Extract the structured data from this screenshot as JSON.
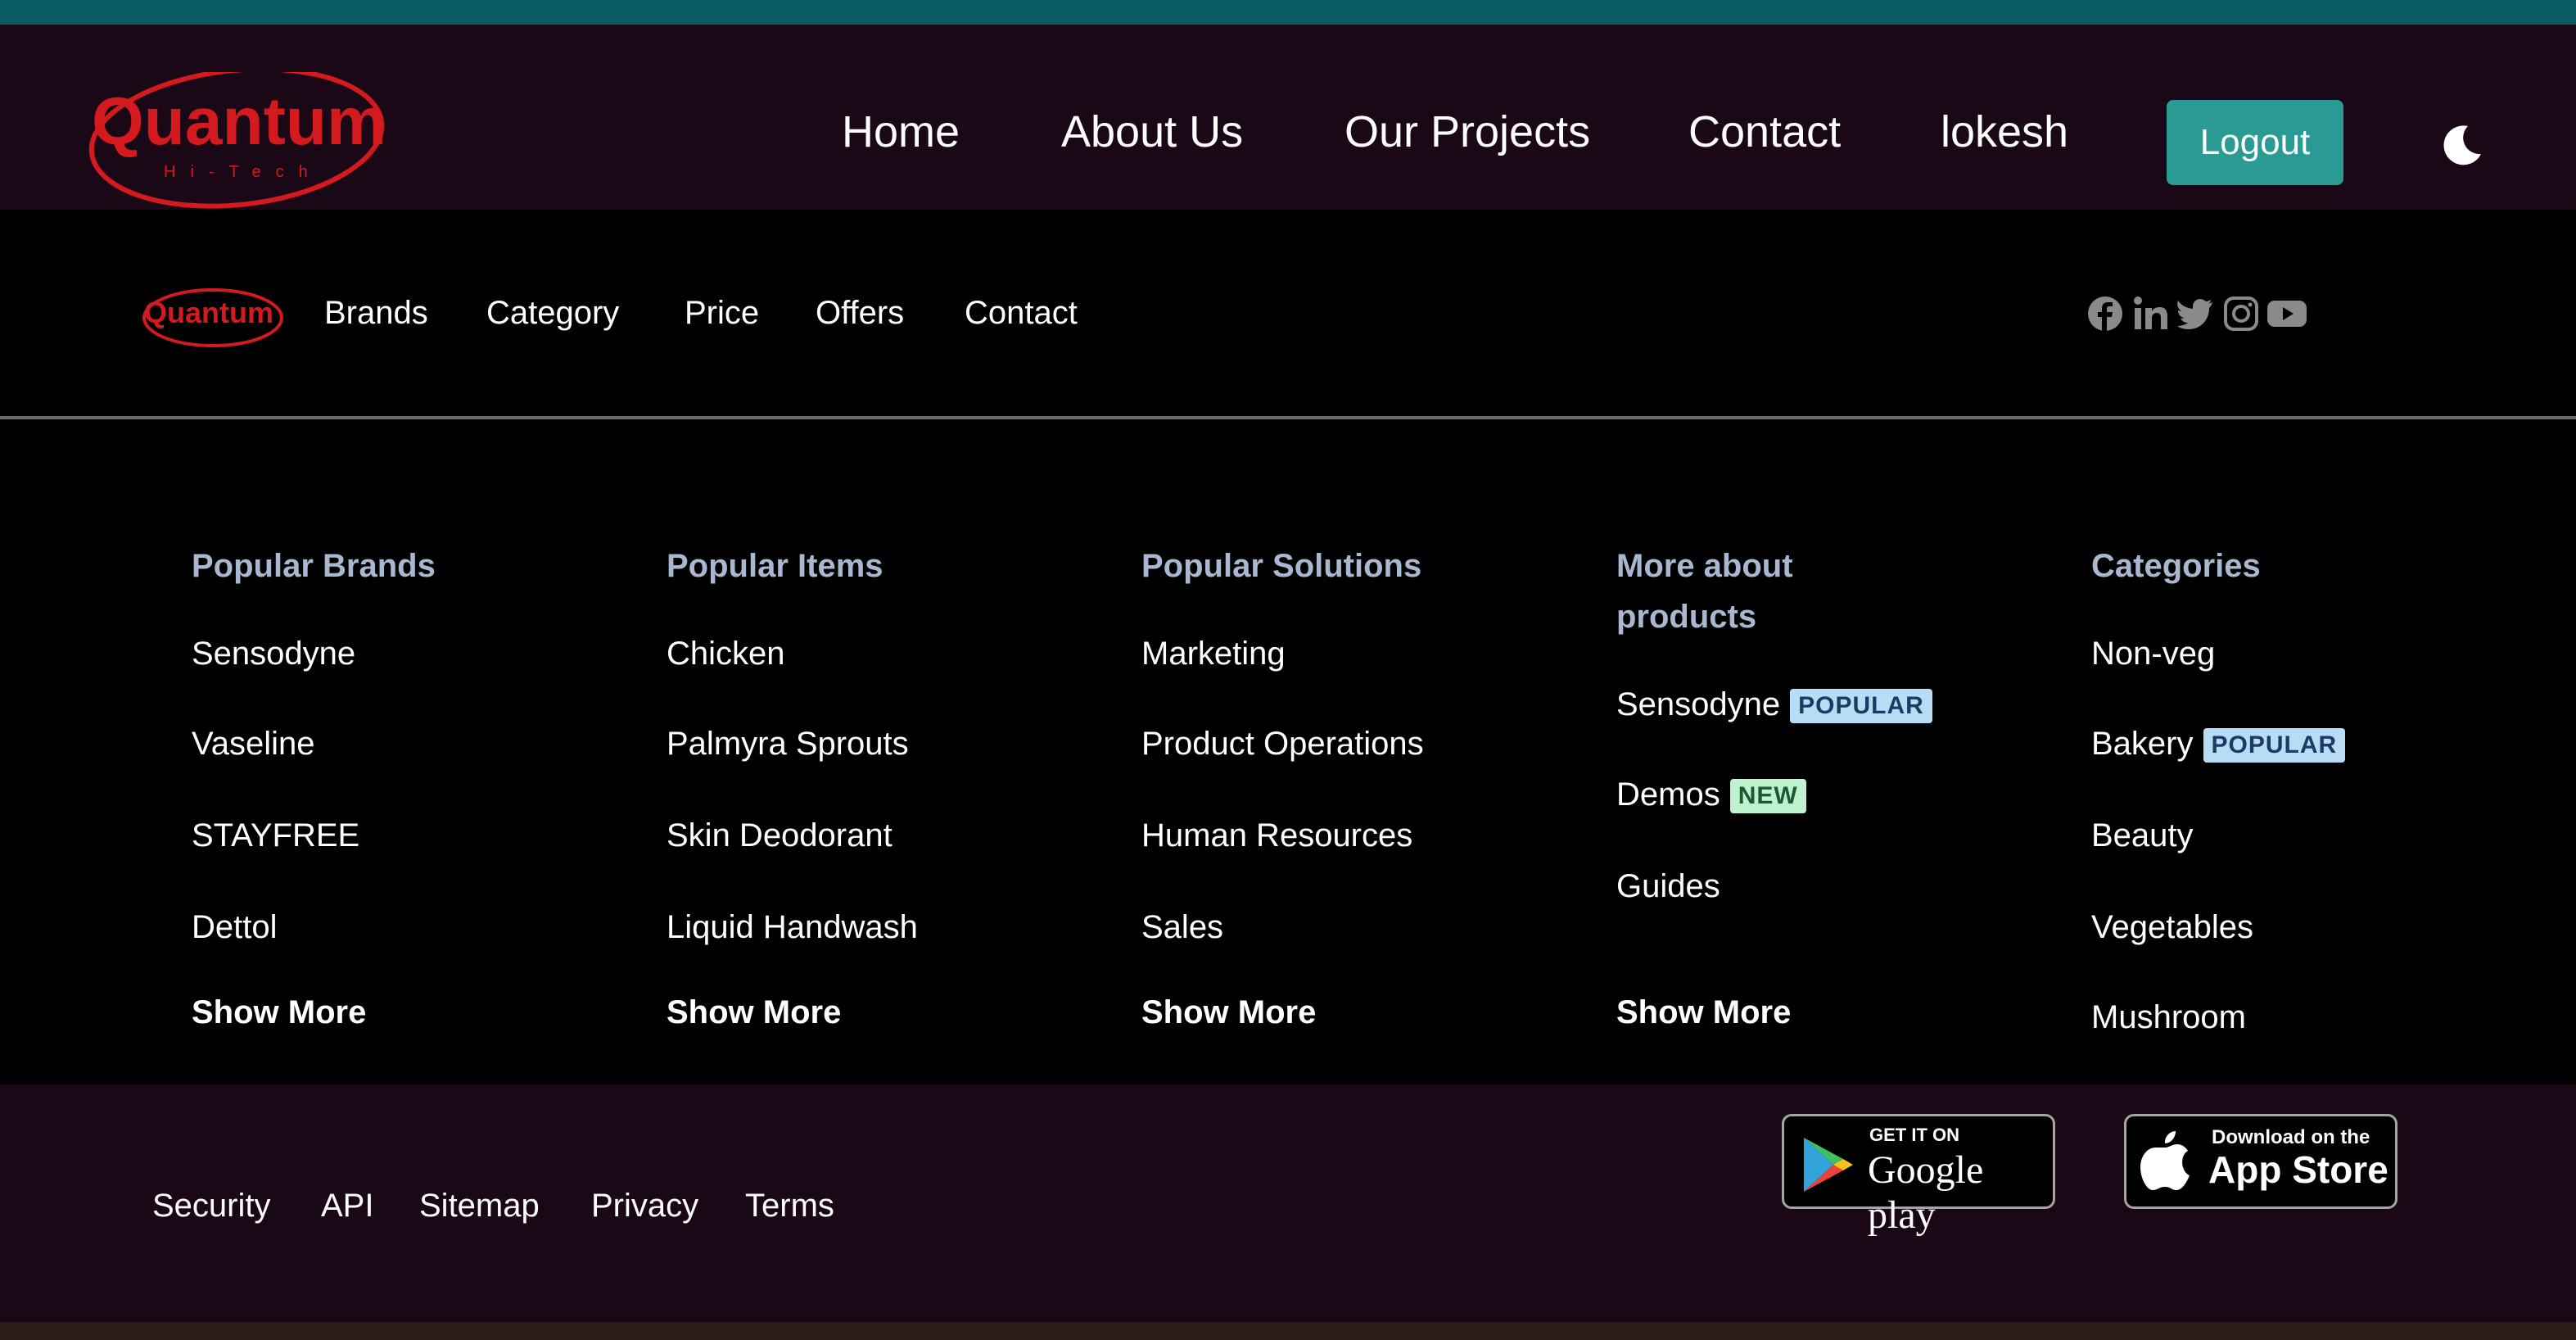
{
  "header": {
    "logo_text": "Quantum",
    "logo_subtext": "Hi-Tech",
    "nav": [
      "Home",
      "About Us",
      "Our Projects",
      "Contact",
      "lokesh"
    ],
    "logout_label": "Logout",
    "theme_icon": "moon-icon"
  },
  "subnav": {
    "logo_text": "Quantum",
    "links": [
      "Brands",
      "Category",
      "Price",
      "Offers",
      "Contact"
    ],
    "social_icons": [
      "facebook-icon",
      "linkedin-icon",
      "twitter-icon",
      "instagram-icon",
      "youtube-icon"
    ]
  },
  "columns": [
    {
      "title": "Popular Brands",
      "items": [
        "Sensodyne",
        "Vaseline",
        "STAYFREE",
        "Dettol"
      ],
      "show_more": "Show More"
    },
    {
      "title": "Popular Items",
      "items": [
        "Chicken",
        "Palmyra Sprouts",
        "Skin Deodorant",
        "Liquid Handwash"
      ],
      "show_more": "Show More"
    },
    {
      "title": "Popular Solutions",
      "items": [
        "Marketing",
        "Product Operations",
        "Human Resources",
        "Sales"
      ],
      "show_more": "Show More"
    },
    {
      "title": "More about products",
      "items": [
        {
          "label": "Sensodyne",
          "badge": "POPULAR"
        },
        {
          "label": "Demos",
          "badge": "NEW"
        },
        {
          "label": "Guides",
          "badge": ""
        }
      ],
      "show_more": "Show More"
    },
    {
      "title": "Categories",
      "items": [
        {
          "label": "Non-veg",
          "badge": ""
        },
        {
          "label": "Bakery",
          "badge": "POPULAR"
        },
        {
          "label": "Beauty",
          "badge": ""
        },
        {
          "label": "Vegetables",
          "badge": ""
        },
        {
          "label": "Mushroom",
          "badge": ""
        }
      ]
    }
  ],
  "footer": {
    "links": [
      "Security",
      "API",
      "Sitemap",
      "Privacy",
      "Terms"
    ],
    "google_play": {
      "small": "GET IT ON",
      "big": "Google play"
    },
    "app_store": {
      "small": "Download on the",
      "big": "App Store"
    }
  },
  "colors": {
    "topbar_bg": "#1a0816",
    "accent_teal": "#2a9a94",
    "column_title": "#a9b7d0",
    "logo_red": "#d4191f"
  }
}
